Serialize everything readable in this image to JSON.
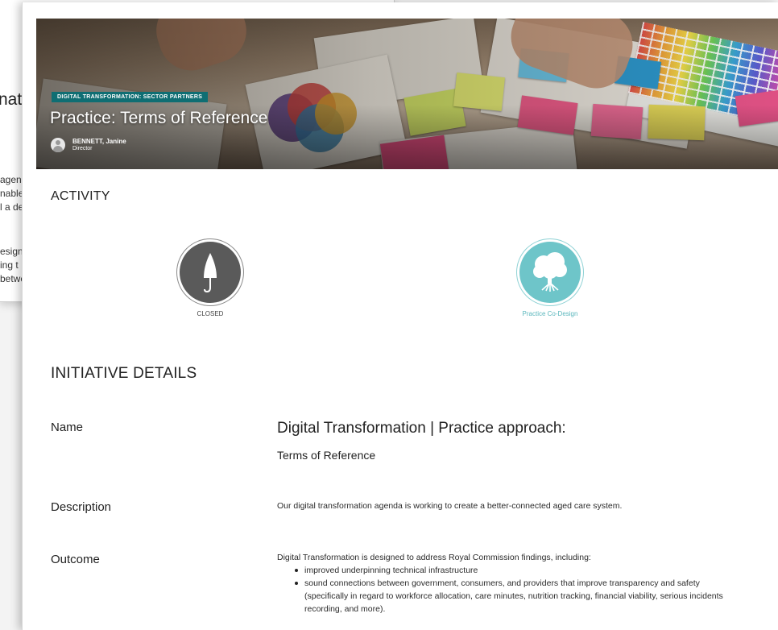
{
  "background_window": {
    "title_fragment": "nati",
    "lines": [
      "agen",
      "nable",
      "l a de",
      "esign",
      "ing t",
      "betwe"
    ]
  },
  "hero": {
    "tag": "DIGITAL TRANSFORMATION: SECTOR PARTNERS",
    "title": "Practice: Terms of Reference",
    "author_name": "BENNETT, Janine",
    "author_role": "Director"
  },
  "activity": {
    "heading": "ACTIVITY",
    "items": [
      {
        "label": "CLOSED",
        "icon": "closed-umbrella-icon",
        "color": "#5a5a5a"
      },
      {
        "label": "Practice Co-Design",
        "icon": "tree-icon",
        "color": "#6ec5c9"
      }
    ]
  },
  "details": {
    "heading": "INITIATIVE DETAILS",
    "name_label": "Name",
    "name_value": "Digital Transformation | Practice approach:",
    "name_sub": "Terms of Reference",
    "description_label": "Description",
    "description_value": "Our digital transformation agenda is working to create a better-connected aged care system.",
    "outcome_label": "Outcome",
    "outcome_intro": "Digital Transformation is designed to address Royal Commission findings, including:",
    "outcome_items": [
      "improved underpinning technical infrastructure",
      "sound connections between government, consumers, and providers that improve transparency and safety (specifically in regard to workforce allocation, care minutes, nutrition tracking, financial viability, serious incidents recording, and more)."
    ]
  }
}
